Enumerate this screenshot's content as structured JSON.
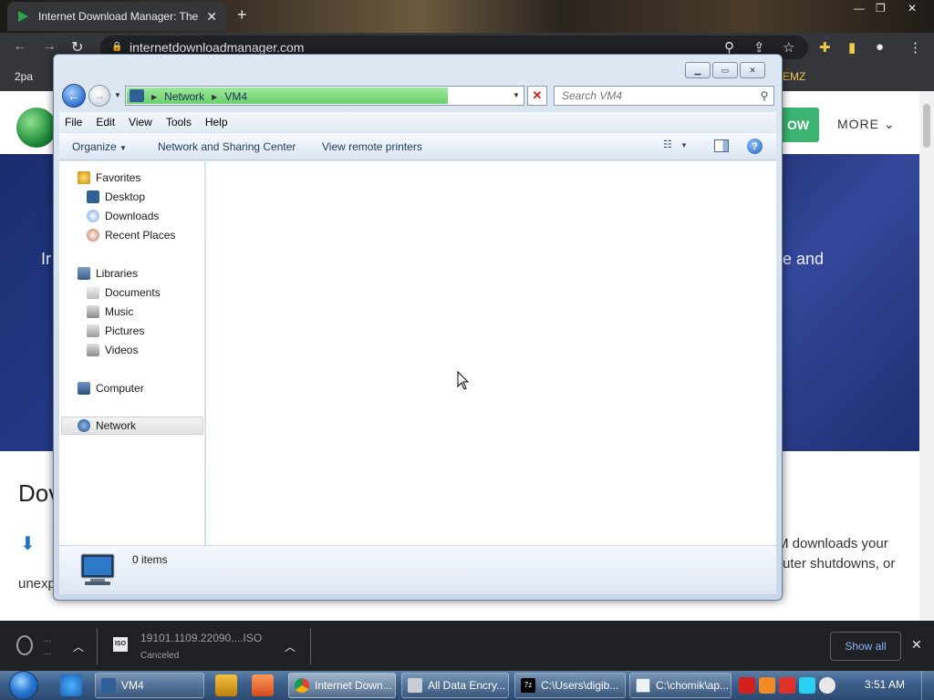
{
  "browser": {
    "tab_title": "Internet Download Manager: The",
    "new_tab": "+",
    "url": "internetdownloadmanager.com",
    "bookmarks_left": "2pa",
    "bookmarks_right": "EMZ"
  },
  "webpage": {
    "cta_label": "OW",
    "more_label": "MORE",
    "hero_left": "Ir",
    "hero_right": "e and",
    "heading_left": "Dov",
    "body_right_1": "M downloads your",
    "body_right_2": "uter shutdowns, or",
    "body_left_3": "unexp"
  },
  "download_bar": {
    "item1_line1": "...",
    "item1_line2": "...",
    "item2_icon_text": "ISO",
    "item2_name": "19101.1109.22090....ISO",
    "item2_status": "Canceled",
    "show_all_label": "Show all"
  },
  "explorer": {
    "address": {
      "segment1": "Network",
      "segment2": "VM4",
      "load_progress": 0.81
    },
    "search_placeholder": "Search VM4",
    "menu": [
      "File",
      "Edit",
      "View",
      "Tools",
      "Help"
    ],
    "commands": {
      "organize": "Organize",
      "network_sharing": "Network and Sharing Center",
      "remote_printers": "View remote printers",
      "help_glyph": "?"
    },
    "nav": {
      "favorites": "Favorites",
      "desktop": "Desktop",
      "downloads": "Downloads",
      "recent_places": "Recent Places",
      "libraries": "Libraries",
      "documents": "Documents",
      "music": "Music",
      "pictures": "Pictures",
      "videos": "Videos",
      "computer": "Computer",
      "network": "Network"
    },
    "details_count": "0 items"
  },
  "taskbar": {
    "tasks": {
      "vm4": "VM4",
      "chrome": "Internet Down...",
      "encryption": "All Data Encry...",
      "sevenzip": "C:\\Users\\digib...",
      "console": "C:\\chomik\\ap..."
    },
    "clock": "3:51 AM"
  },
  "colors": {
    "accent_green": "#3cb371",
    "hero_blue": "#243a8a",
    "progress_green": "#6cd06c",
    "link_blue": "#8ab4f8"
  }
}
